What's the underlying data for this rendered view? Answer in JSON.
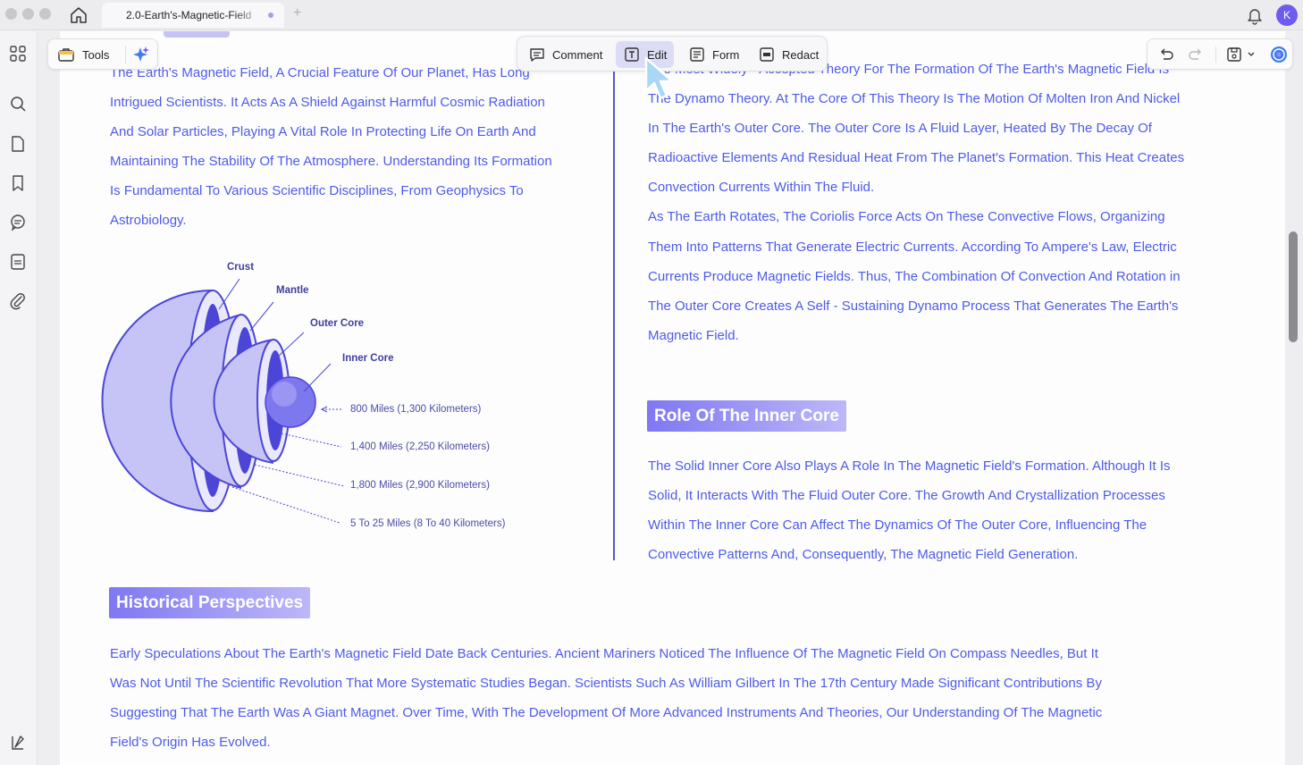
{
  "tab": {
    "title": "2.0-Earth's-Magnetic-Field"
  },
  "user": {
    "initial": "K"
  },
  "toolbar": {
    "tools_label": "Tools",
    "comment_label": "Comment",
    "edit_label": "Edit",
    "form_label": "Form",
    "redact_label": "Redact"
  },
  "document": {
    "intro_lines": [
      "The Earth's Magnetic Field, A Crucial Feature Of Our Planet, Has Long",
      "Intrigued Scientists. It Acts As A Shield Against Harmful Cosmic Radiation",
      "And Solar Particles, Playing A Vital Role In Protecting Life On Earth And",
      "Maintaining The Stability Of The Atmosphere. Understanding Its Formation",
      "Is Fundamental To Various Scientific Disciplines, From Geophysics To",
      "Astrobiology."
    ],
    "dynamo_lines": [
      "The Most Widely - Accepted Theory For The Formation Of The Earth's Magnetic Field Is",
      "The Dynamo Theory. At The Core Of This Theory Is The Motion Of Molten Iron And Nickel",
      "In The Earth's Outer Core. The Outer Core Is A Fluid Layer, Heated By The Decay Of",
      "Radioactive Elements And Residual Heat From The Planet's Formation. This Heat Creates",
      "Convection Currents Within The Fluid.",
      "As The Earth Rotates, The Coriolis Force Acts On These Convective Flows, Organizing",
      "Them Into Patterns That Generate Electric Currents. According To Ampere's Law, Electric",
      "Currents Produce Magnetic Fields. Thus, The Combination Of Convection And Rotation in",
      "The Outer Core Creates A Self - Sustaining Dynamo Process That Generates The Earth's",
      "Magnetic Field."
    ],
    "inner_core_heading": "Role Of The Inner Core",
    "inner_core_lines": [
      "The Solid Inner Core Also Plays A Role In The Magnetic Field's Formation. Although It Is",
      "Solid, It Interacts With The Fluid Outer Core. The Growth And Crystallization Processes",
      "Within The Inner Core Can Affect The Dynamics Of The Outer Core, Influencing The",
      "Convective Patterns And, Consequently, The Magnetic Field Generation."
    ],
    "history_heading": "Historical Perspectives",
    "history_lines": [
      "Early Speculations About The Earth's Magnetic Field Date Back Centuries. Ancient Mariners Noticed The Influence Of The Magnetic Field On Compass Needles, But It",
      "Was Not Until The Scientific Revolution That More Systematic Studies Began. Scientists Such As William Gilbert In The 17th Century Made Significant Contributions By",
      "Suggesting That The Earth Was A Giant Magnet. Over Time, With The Development Of More Advanced Instruments And Theories, Our Understanding Of The Magnetic",
      "Field's Origin Has Evolved."
    ]
  },
  "diagram": {
    "labels": {
      "crust": "Crust",
      "mantle": "Mantle",
      "outer_core": "Outer Core",
      "inner_core": "Inner Core"
    },
    "measurements": [
      "800 Miles (1,300 Kilometers)",
      "1,400 Miles (2,250 Kilometers)",
      "1,800 Miles (2,900 Kilometers)",
      "5 To 25 Miles (8 To 40 Kilometers)"
    ]
  },
  "colors": {
    "accent": "#6d5cf2",
    "text_blue": "#4e5be8",
    "diagram_fill": "#c6c4f6",
    "diagram_stroke": "#4b46d8"
  }
}
